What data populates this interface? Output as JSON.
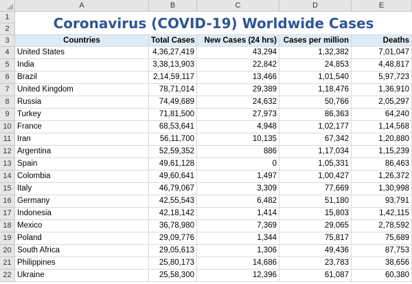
{
  "sheet": {
    "title": "Coronavirus (COVID-19) Worldwide Cases",
    "column_letters": [
      "A",
      "B",
      "C",
      "D",
      "E"
    ],
    "row_numbers": [
      "1",
      "2",
      "3",
      "4",
      "5",
      "6",
      "7",
      "8",
      "9",
      "10",
      "11",
      "12",
      "13",
      "14",
      "15",
      "16",
      "17",
      "18",
      "19",
      "20",
      "21",
      "22"
    ],
    "headers": [
      "Countries",
      "Total Cases",
      "New Cases (24 hrs)",
      "Cases per million",
      "Deaths"
    ],
    "rows": [
      [
        "United States",
        "4,36,27,419",
        "43,294",
        "1,32,382",
        "7,01,047"
      ],
      [
        "India",
        "3,38,13,903",
        "22,842",
        "24,853",
        "4,48,817"
      ],
      [
        "Brazil",
        "2,14,59,117",
        "13,466",
        "1,01,540",
        "5,97,723"
      ],
      [
        "United Kingdom",
        "78,71,014",
        "29,389",
        "1,18,476",
        "1,36,910"
      ],
      [
        "Russia",
        "74,49,689",
        "24,632",
        "50,766",
        "2,05,297"
      ],
      [
        "Turkey",
        "71,81,500",
        "27,973",
        "86,363",
        "64,240"
      ],
      [
        "France",
        "68,53,641",
        "4,948",
        "1,02,177",
        "1,14,568"
      ],
      [
        "Iran",
        "56,11,700",
        "10,135",
        "67,342",
        "1,20,880"
      ],
      [
        "Argentina",
        "52,59,352",
        "886",
        "1,17,034",
        "1,15,239"
      ],
      [
        "Spain",
        "49,61,128",
        "0",
        "1,05,331",
        "86,463"
      ],
      [
        "Colombia",
        "49,60,641",
        "1,497",
        "1,00,427",
        "1,26,372"
      ],
      [
        "Italy",
        "46,79,067",
        "3,309",
        "77,669",
        "1,30,998"
      ],
      [
        "Germany",
        "42,55,543",
        "6,482",
        "51,180",
        "93,791"
      ],
      [
        "Indonesia",
        "42,18,142",
        "1,414",
        "15,803",
        "1,42,115"
      ],
      [
        "Mexico",
        "36,78,980",
        "7,369",
        "29,065",
        "2,78,592"
      ],
      [
        "Poland",
        "29,09,776",
        "1,344",
        "75,817",
        "75,689"
      ],
      [
        "South Africa",
        "29,05,613",
        "1,306",
        "49,436",
        "87,753"
      ],
      [
        "Philippines",
        "25,80,173",
        "14,686",
        "23,783",
        "38,656"
      ],
      [
        "Ukraine",
        "25,58,300",
        "12,396",
        "61,087",
        "60,380"
      ]
    ]
  },
  "colors": {
    "title": "#2f5597",
    "header_fill": "#ddebf7"
  }
}
